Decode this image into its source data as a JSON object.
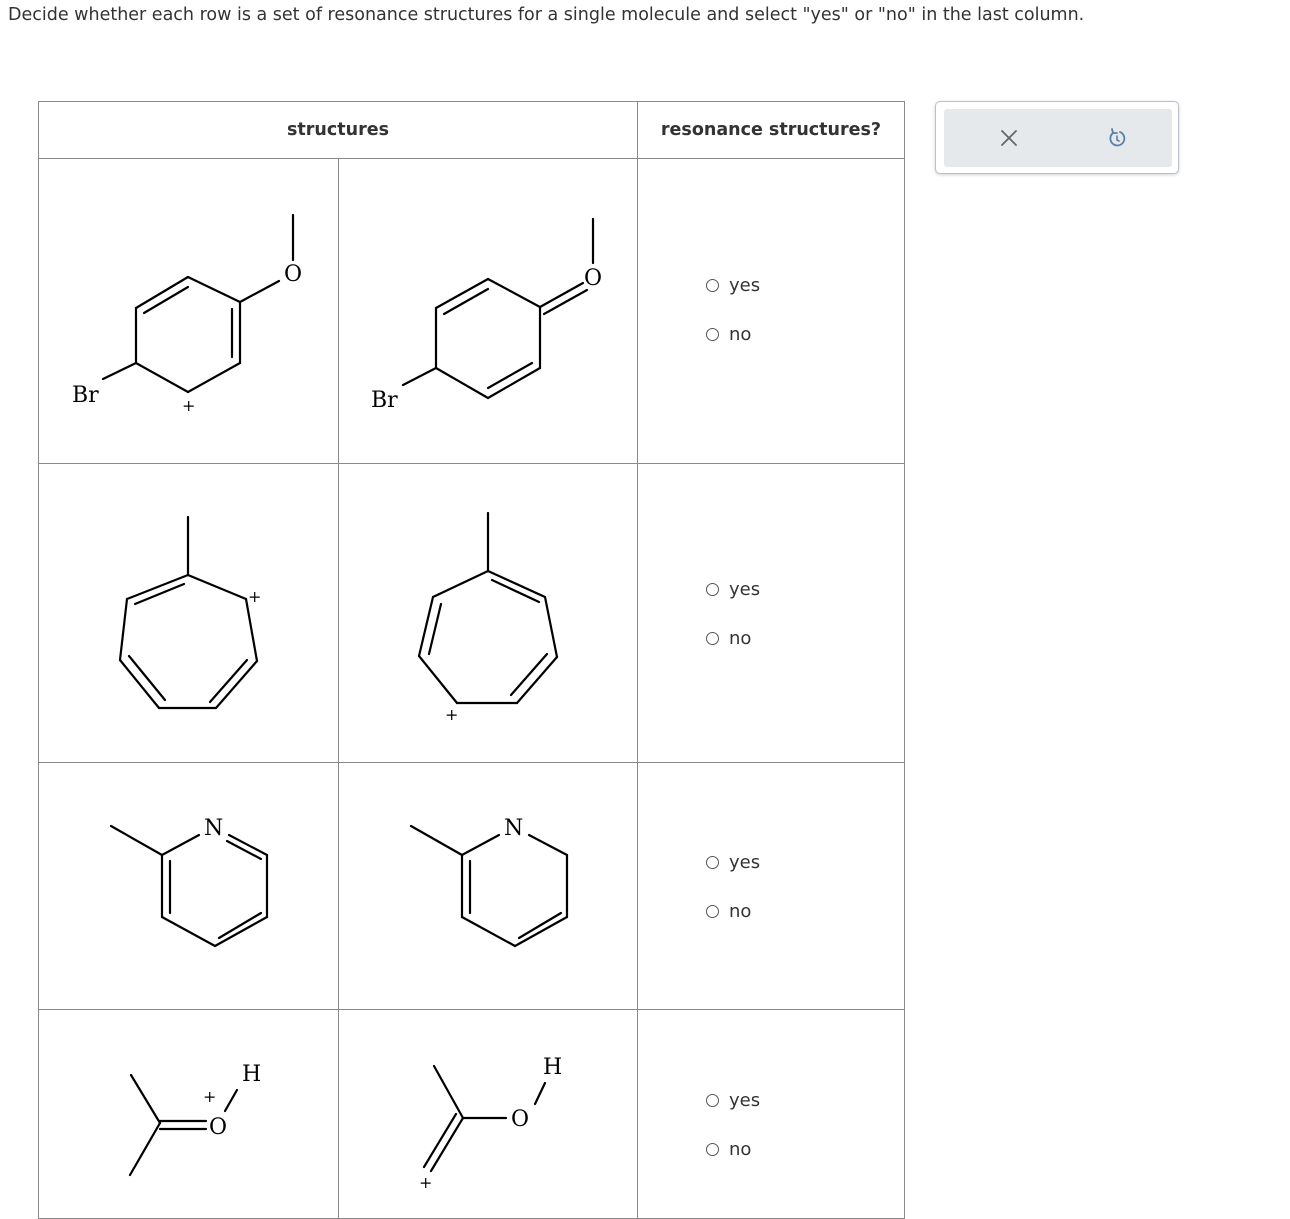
{
  "instructions": "Decide whether each row is a set of resonance structures for a single molecule and select \"yes\" or \"no\" in the last column.",
  "table": {
    "headers": {
      "structures": "structures",
      "resonance": "resonance structures?"
    },
    "rows": [
      {
        "options": {
          "yes": "yes",
          "no": "no"
        },
        "left_labels": [
          "Br",
          "O",
          "+"
        ],
        "right_labels": [
          "Br",
          "O"
        ]
      },
      {
        "options": {
          "yes": "yes",
          "no": "no"
        },
        "left_labels": [
          "+"
        ],
        "right_labels": [
          "+"
        ]
      },
      {
        "options": {
          "yes": "yes",
          "no": "no"
        },
        "left_labels": [
          "N"
        ],
        "right_labels": [
          "N"
        ]
      },
      {
        "options": {
          "yes": "yes",
          "no": "no"
        },
        "left_labels": [
          "H",
          "+",
          "O"
        ],
        "right_labels": [
          "H",
          "O",
          "+"
        ]
      }
    ]
  },
  "toolbar": {
    "clear_icon": "close-icon",
    "undo_icon": "undo-icon"
  }
}
